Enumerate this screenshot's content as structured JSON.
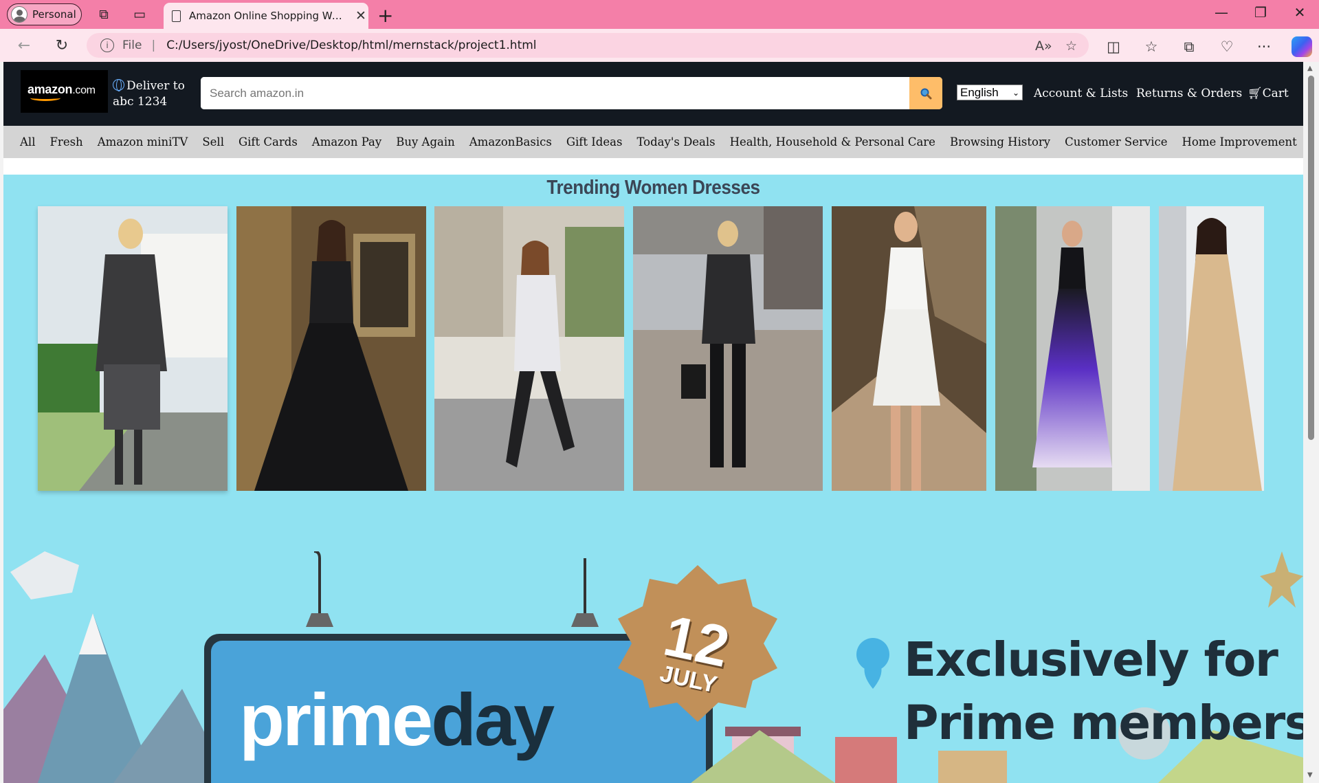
{
  "browser": {
    "profile_label": "Personal",
    "tab_title": "Amazon Online Shopping Website",
    "address_scheme_label": "File",
    "address_url": "C:/Users/jyost/OneDrive/Desktop/html/mernstack/project1.html"
  },
  "header": {
    "logo_text": "amazon",
    "logo_suffix": ".com",
    "deliver_line1": "Deliver to",
    "deliver_line2": "abc 1234",
    "search_placeholder": "Search amazon.in",
    "search_icon": "magnifier-icon",
    "language_selected": "English",
    "account_link": "Account & Lists",
    "orders_link": "Returns & Orders",
    "cart_label": "Cart"
  },
  "subnav": {
    "items": [
      "All",
      "Fresh",
      "Amazon miniTV",
      "Sell",
      "Gift Cards",
      "Amazon Pay",
      "Buy Again",
      "AmazonBasics",
      "Gift Ideas",
      "Today's Deals",
      "Health, Household & Personal Care",
      "Browsing History",
      "Customer Service",
      "Home Improvement"
    ]
  },
  "trending": {
    "title": "Trending Women Dresses",
    "items": [
      {
        "name": "grey-skirt-suit-photo"
      },
      {
        "name": "black-gown-photo"
      },
      {
        "name": "white-sweater-dress-boots-photo"
      },
      {
        "name": "grey-sweater-black-jeans-photo"
      },
      {
        "name": "white-summer-dress-photo"
      },
      {
        "name": "purple-ombre-maxi-dress-photo"
      },
      {
        "name": "beige-embellished-gown-photo"
      }
    ]
  },
  "banner": {
    "date_day": "12",
    "date_month": "JULY",
    "brand_word_1": "prime",
    "brand_word_2": "day",
    "tagline_line1": "Exclusively for",
    "tagline_line2": "Prime members"
  },
  "colors": {
    "tabstrip": "#f47fa8",
    "header_bg": "#131921",
    "search_button": "#febd69",
    "subnav_bg": "#d4d4d4",
    "content_bg": "#90e2f1"
  }
}
